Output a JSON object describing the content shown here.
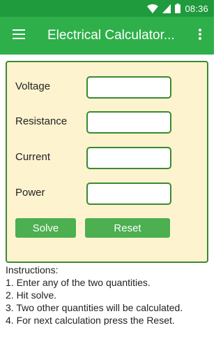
{
  "status_bar": {
    "time": "08:36"
  },
  "app_bar": {
    "title": "Electrical Calculator..."
  },
  "form": {
    "fields": [
      {
        "label": "Voltage",
        "value": ""
      },
      {
        "label": "Resistance",
        "value": ""
      },
      {
        "label": "Current",
        "value": ""
      },
      {
        "label": "Power",
        "value": ""
      }
    ],
    "solve_label": "Solve",
    "reset_label": "Reset"
  },
  "instructions": {
    "heading": "Instructions:",
    "steps": [
      "1. Enter any of the two quantities.",
      "2. Hit solve.",
      "3. Two other quantities will be calculated.",
      "4. For next calculation press the Reset."
    ]
  },
  "colors": {
    "status_bar": "#1f9a3c",
    "app_bar": "#2eaf4a",
    "panel_bg": "#fdf3cf",
    "border": "#3b8a2f",
    "button": "#4caf50"
  }
}
